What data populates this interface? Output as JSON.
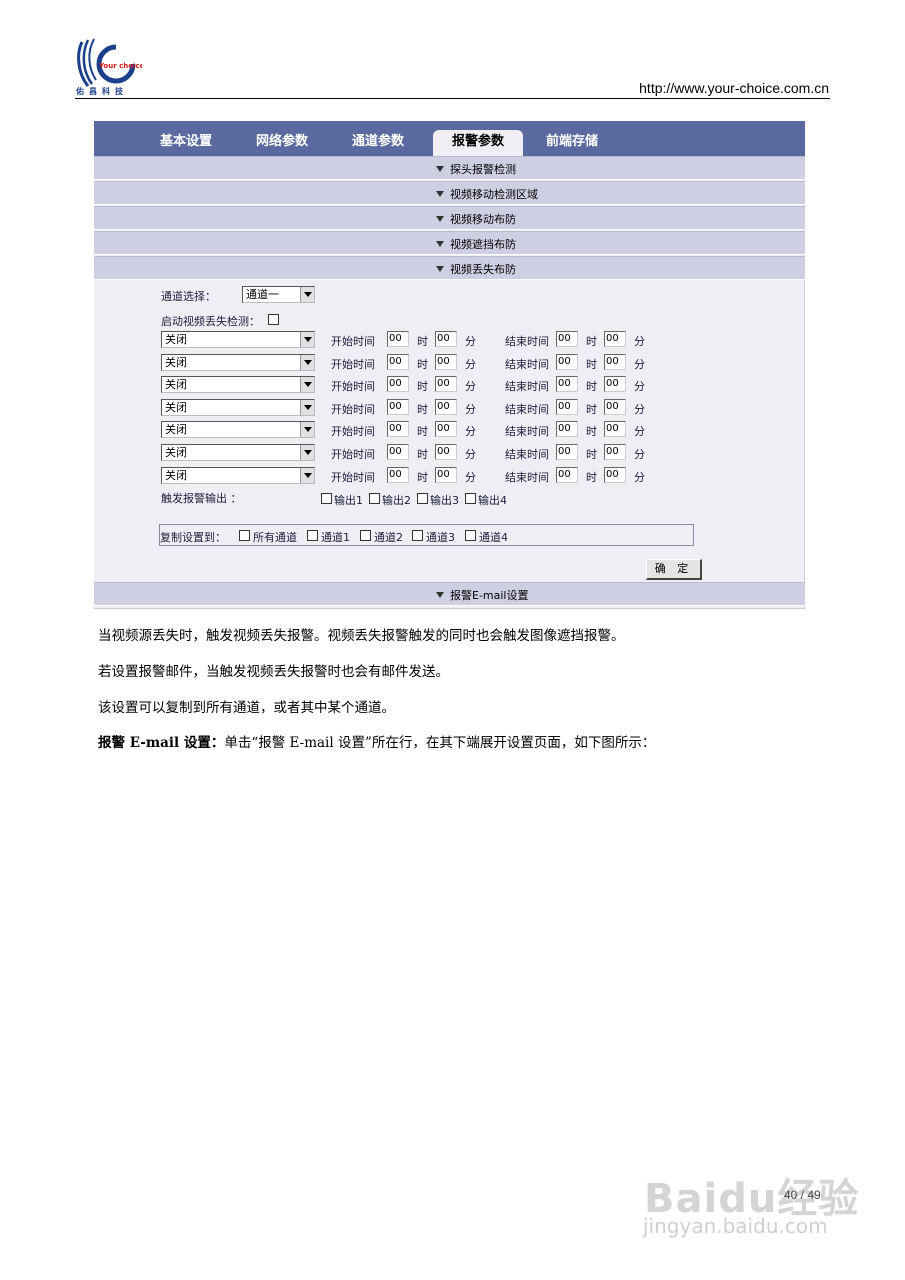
{
  "header": {
    "logo_text": "Your choice",
    "logo_caption": "佑昌科技",
    "url": "http://www.your-choice.com.cn"
  },
  "ui": {
    "tabs": [
      "基本设置",
      "网络参数",
      "通道参数",
      "报警参数",
      "前端存储"
    ],
    "active_tab": "报警参数",
    "sections": [
      "探头报警检测",
      "视频移动检测区域",
      "视频移动布防",
      "视频遮挡布防",
      "视频丢失布防"
    ],
    "channel_label": "通道选择：",
    "channel_value": "通道一",
    "enable_label": "启动视频丢失检测：",
    "schedule": {
      "rows": [
        {
          "mode": "关闭",
          "start_h": "00",
          "start_m": "00",
          "end_h": "00",
          "end_m": "00"
        },
        {
          "mode": "关闭",
          "start_h": "00",
          "start_m": "00",
          "end_h": "00",
          "end_m": "00"
        },
        {
          "mode": "关闭",
          "start_h": "00",
          "start_m": "00",
          "end_h": "00",
          "end_m": "00"
        },
        {
          "mode": "关闭",
          "start_h": "00",
          "start_m": "00",
          "end_h": "00",
          "end_m": "00"
        },
        {
          "mode": "关闭",
          "start_h": "00",
          "start_m": "00",
          "end_h": "00",
          "end_m": "00"
        },
        {
          "mode": "关闭",
          "start_h": "00",
          "start_m": "00",
          "end_h": "00",
          "end_m": "00"
        },
        {
          "mode": "关闭",
          "start_h": "00",
          "start_m": "00",
          "end_h": "00",
          "end_m": "00"
        }
      ],
      "start_label": "开始时间",
      "end_label": "结束时间",
      "hour_label": "时",
      "minute_label": "分"
    },
    "trigger_label": "触发报警输出 ：",
    "outputs": [
      "输出1",
      "输出2",
      "输出3",
      "输出4"
    ],
    "copy_label": "复制设置到：",
    "copy_targets": [
      "所有通道",
      "通道1",
      "通道2",
      "通道3",
      "通道4"
    ],
    "ok_label": "确 定",
    "email_section": "报警E-mail设置"
  },
  "paragraphs": {
    "p1": "当视频源丢失时，触发视频丢失报警。视频丢失报警触发的同时也会触发图像遮挡报警。",
    "p2": "若设置报警邮件，当触发视频丢失报警时也会有邮件发送。",
    "p3": "该设置可以复制到所有通道，或者其中某个通道。",
    "p4_bold": "报警 E-mail 设置：",
    "p4_rest": "单击“报警 E-mail 设置”所在行，在其下端展开设置页面，如下图所示："
  },
  "footer": {
    "page_number": "40 / 49",
    "watermark": "Baidu经验",
    "watermark_url": "jingyan.baidu.com"
  }
}
